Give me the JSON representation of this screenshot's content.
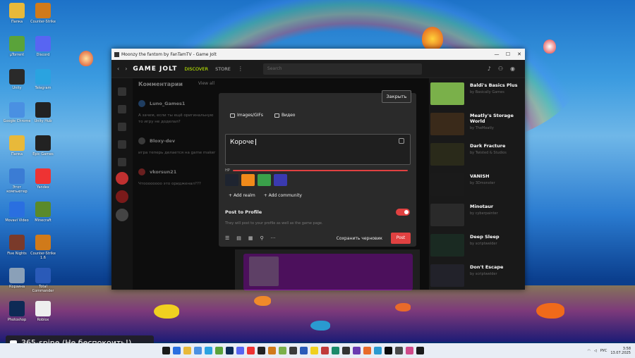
{
  "desktop": {
    "icons": [
      {
        "label": "Папка",
        "color": "#e8b93a"
      },
      {
        "label": "µTorrent",
        "color": "#5aa33a"
      },
      {
        "label": "Unity",
        "color": "#2a2a2a"
      },
      {
        "label": "Google Chrome",
        "color": "#4a90e2"
      },
      {
        "label": "Папка",
        "color": "#e8b93a"
      },
      {
        "label": "Этот компьютер",
        "color": "#3b7cd4"
      },
      {
        "label": "Movavi Video",
        "color": "#2a6fe0"
      },
      {
        "label": "Five Nights",
        "color": "#7a3a2a"
      },
      {
        "label": "Корзина",
        "color": "#8aa0b8"
      },
      {
        "label": "Photoshop",
        "color": "#0d2a55"
      },
      {
        "label": "Counter-Strike",
        "color": "#d07a1a"
      },
      {
        "label": "Discord",
        "color": "#5865f2"
      },
      {
        "label": "Telegram",
        "color": "#2aa3e0"
      },
      {
        "label": "Unity Hub",
        "color": "#222"
      },
      {
        "label": "Epic Games",
        "color": "#222"
      },
      {
        "label": "Yandex",
        "color": "#e33"
      },
      {
        "label": "Minecraft",
        "color": "#5a8a2a"
      },
      {
        "label": "Counter-Strike 1.6",
        "color": "#d07a1a"
      },
      {
        "label": "Total Commander",
        "color": "#2a5ab8"
      },
      {
        "label": "Roblox",
        "color": "#eee"
      }
    ]
  },
  "window": {
    "title": "Moonzy the fantom by FanTamTV - Game Jolt",
    "brand": "GAME JOLT",
    "nav": [
      {
        "label": "DISCOVER",
        "active": true
      },
      {
        "label": "STORE",
        "active": false
      }
    ],
    "search_placeholder": "Search"
  },
  "comments": {
    "header": "Комментарии",
    "view_all": "View all",
    "items": [
      {
        "user": "Luno_Games1",
        "text": "А зачем, если ты ещё оригинальную",
        "text2": "то игру не доделал?",
        "avatar": "#3a6fb0"
      },
      {
        "user": "Bloxy-dev",
        "text": "игра теперь делается на game maker",
        "text2": "",
        "avatar": "#6a6a6a"
      },
      {
        "user": "vkorsun21",
        "text": "Чтоооооооо это оридженал???",
        "text2": "",
        "avatar": "#c03a3a"
      }
    ]
  },
  "modal": {
    "close_label": "Закрыть",
    "tab_images": "Images/GIFs",
    "tab_video": "Видео",
    "text_value": "Короче",
    "hp_label": "HP",
    "swatch_colors": [
      "#1e2430",
      "#f08a1a",
      "#3aa04a",
      "#3a3ab0"
    ],
    "add_realm": "Add realm",
    "add_community": "Add community",
    "post_to_profile": "Post to Profile",
    "post_to_profile_on": true,
    "description": "They will post to your profile as well as the game page.",
    "save_draft": "Сохранить черновик",
    "post": "Post"
  },
  "games": [
    {
      "title": "Baldi's Basics Plus",
      "sub": "by Basically Games",
      "color": "#7ab04a"
    },
    {
      "title": "Meatly's Storage World",
      "sub": "by TheMeatly",
      "color": "#3a2a1a"
    },
    {
      "title": "Dark Fracture",
      "sub": "by Twisted & Studios",
      "color": "#2a2a1a"
    },
    {
      "title": "VANISH",
      "sub": "by 3Dmonster",
      "color": "#1a1a1a"
    },
    {
      "title": "Minotaur",
      "sub": "by cyberpainter",
      "color": "#2a2a2a"
    },
    {
      "title": "Deep Sleep",
      "sub": "by scriptwelder",
      "color": "#1a2a22"
    },
    {
      "title": "Don't Escape",
      "sub": "by scriptwelder",
      "color": "#22222a"
    }
  ],
  "notification": "365-spine (Не беспокоить!)",
  "taskbar": {
    "lang": "РУС",
    "time": "3:58",
    "date": "13.07.2025"
  }
}
